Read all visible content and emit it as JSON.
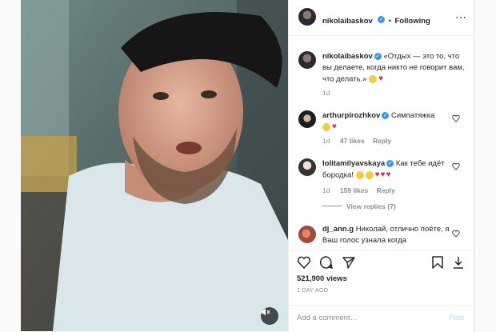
{
  "post": {
    "author": "nikolaibaskov",
    "follow_separator": "•",
    "follow_status": "Following",
    "more_icon": "ellipsis-icon"
  },
  "caption": {
    "author": "nikolaibaskov",
    "text": "«Отдых — это то, что вы делаете, когда никто не говорит вам, что делать.»",
    "age": "1d"
  },
  "comments": [
    {
      "author": "arthurpirozhkov",
      "text": "Симпатяжка",
      "age": "1d",
      "likes": "47 likes",
      "reply": "Reply"
    },
    {
      "author": "lolitamilyavskaya",
      "text": "Как тебе идёт бородка!",
      "age": "1d",
      "likes": "159 likes",
      "reply": "Reply",
      "view_replies": "View replies (7)"
    },
    {
      "author": "dj_ann.g",
      "text": "Николай, отлично поёте, я Ваш голос узнала когда"
    }
  ],
  "stats": {
    "views": "521,900 views",
    "time": "1 DAY AGO"
  },
  "add_comment": {
    "placeholder": "Add a comment…",
    "post_label": "Post"
  },
  "colors": {
    "link": "#3897f0",
    "heart": "#e0245e",
    "text": "#262626",
    "muted": "#8e8e8e"
  }
}
